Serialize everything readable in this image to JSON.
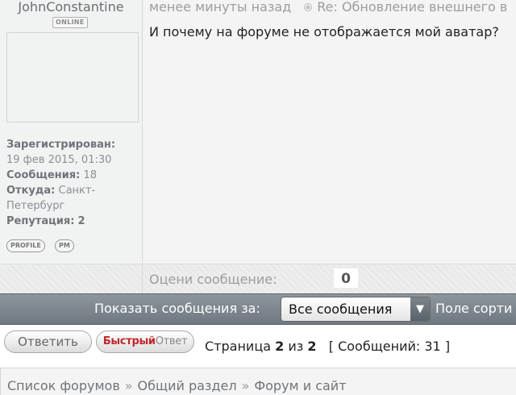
{
  "post": {
    "author": {
      "username": "JohnConstantine",
      "online_badge": "ONLINE",
      "registered_label": "Зарегистрирован:",
      "registered_value": "19 фев 2015, 01:30",
      "messages_label": "Сообщения:",
      "messages_value": "18",
      "from_label": "Откуда:",
      "from_value": "Санкт-Петербург",
      "reputation_label": "Репутация:",
      "reputation_value": "2",
      "profile_button": "PROFILE",
      "pm_button": "PM"
    },
    "header": {
      "time": "менее минуты назад",
      "subject": "Re: Обновление внешнего в"
    },
    "body": "И почему на форуме не отображается мой аватар?",
    "rating": {
      "label": "Оцени сообщение:",
      "value": "0"
    }
  },
  "filter": {
    "label": "Показать сообщения за:",
    "selected": "Все сообщения",
    "sort_label": "Поле сорти"
  },
  "actions": {
    "reply": "Ответить",
    "quick_reply_part1": "Быстрый",
    "quick_reply_part2": "Ответ"
  },
  "pagination": {
    "page_label": "Страница",
    "current": "2",
    "of_label": "из",
    "total": "2",
    "messages_label": "[ Сообщений:",
    "messages_count": "31",
    "close_bracket": "]"
  },
  "breadcrumbs": [
    "Список форумов",
    "Общий раздел",
    "Форум и сайт"
  ],
  "breadcrumb_separator": "»"
}
